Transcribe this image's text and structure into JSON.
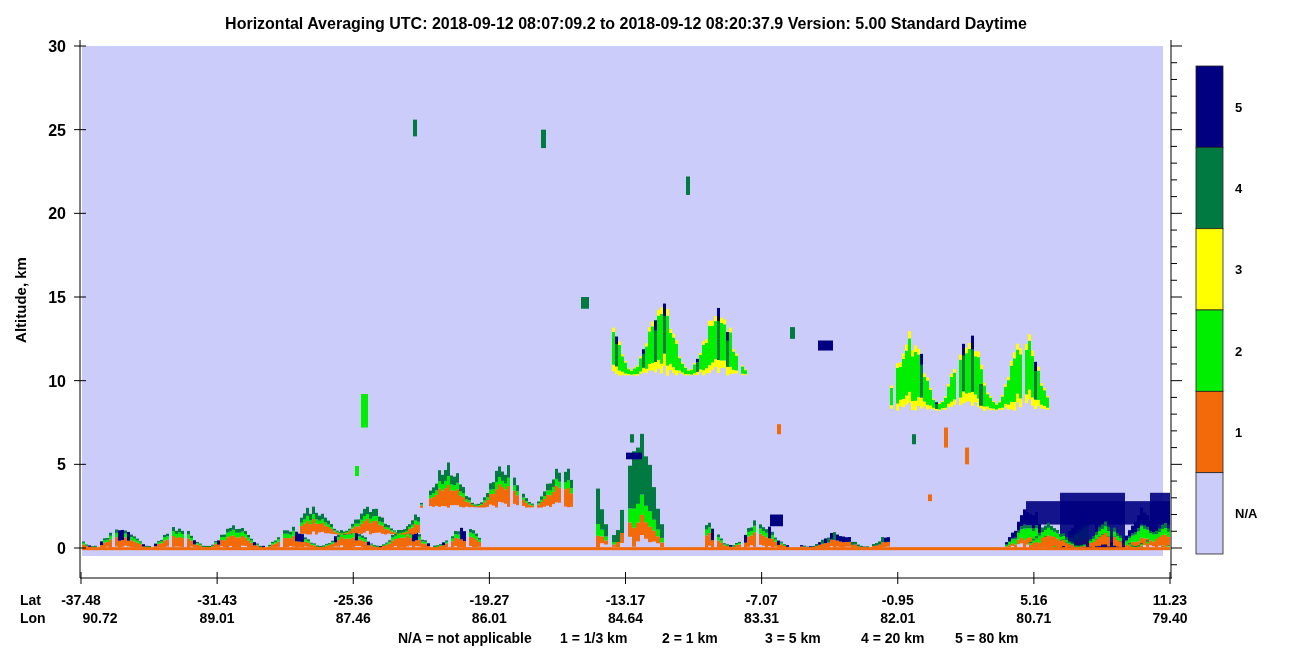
{
  "title": "Horizontal Averaging    UTC:  2018-09-12   08:07:09.2  to  2018-09-12   08:20:37.9    Version: 5.00  Standard Daytime",
  "y_axis": {
    "label": "Altitude, km",
    "ticks": [
      "30",
      "25",
      "20",
      "15",
      "10",
      "5",
      "0"
    ]
  },
  "x_axis": {
    "row_labels": [
      "Lat",
      "Lon"
    ],
    "ticks": [
      {
        "lat": "-37.48",
        "lon": "90.72"
      },
      {
        "lat": "-31.43",
        "lon": "89.01"
      },
      {
        "lat": "-25.36",
        "lon": "87.46"
      },
      {
        "lat": "-19.27",
        "lon": "86.01"
      },
      {
        "lat": "-13.17",
        "lon": "84.64"
      },
      {
        "lat": "-7.07",
        "lon": "83.31"
      },
      {
        "lat": "-0.95",
        "lon": "82.01"
      },
      {
        "lat": "5.16",
        "lon": "80.71"
      },
      {
        "lat": "11.23",
        "lon": "79.40"
      }
    ]
  },
  "legend": {
    "items": [
      {
        "label": "5",
        "color": "#000080"
      },
      {
        "label": "4",
        "color": "#007a40"
      },
      {
        "label": "3",
        "color": "#ffff00"
      },
      {
        "label": "2",
        "color": "#00ee00"
      },
      {
        "label": "1",
        "color": "#f26a0a"
      },
      {
        "label": "N/A",
        "color": "#ccccfa"
      }
    ]
  },
  "footnote": [
    "N/A = not applicable",
    "1 = 1/3 km",
    "2 = 1 km",
    "3 = 5 km",
    "4 = 20 km",
    "5 = 80 km"
  ]
}
